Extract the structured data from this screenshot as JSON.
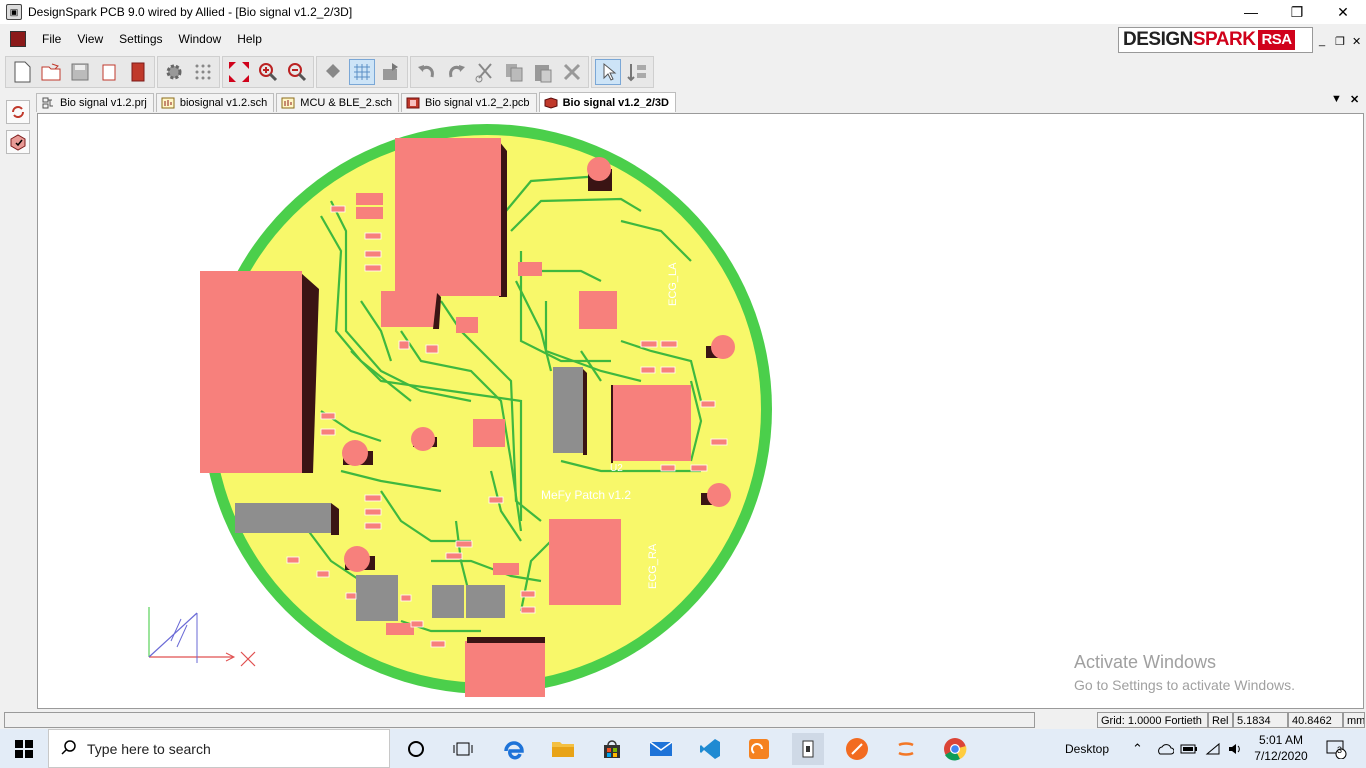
{
  "window": {
    "title": "DesignSpark PCB 9.0 wired by Allied - [Bio signal v1.2_2/3D]"
  },
  "menu": [
    "File",
    "View",
    "Settings",
    "Window",
    "Help"
  ],
  "logo": {
    "part1": "DESIGN",
    "part2": "SPARK",
    "part3": "RSA"
  },
  "tabs": [
    {
      "label": "Bio signal v1.2.prj"
    },
    {
      "label": "biosignal v1.2.sch"
    },
    {
      "label": "MCU & BLE_2.sch"
    },
    {
      "label": "Bio signal v1.2_2.pcb"
    },
    {
      "label": "Bio signal v1.2_2/3D"
    }
  ],
  "board_text": {
    "patch_name": "MeFy Patch v1.2",
    "ecg_la": "ECG_LA",
    "ecg_ra": "ECG_RA",
    "u2": "U2"
  },
  "activate": {
    "line1": "Activate Windows",
    "line2": "Go to Settings to activate Windows."
  },
  "status": {
    "grid": "Grid: 1.0000 Fortieth",
    "rel": "Rel",
    "x": "5.1834",
    "y": "40.8462",
    "units": "mm"
  },
  "taskbar": {
    "search_placeholder": "Type here to search",
    "desktop": "Desktop",
    "time": "5:01 AM",
    "date": "7/12/2020",
    "notifications": "3"
  },
  "colors": {
    "board_yellow": "#f8f86a",
    "board_rim": "#4bcf4b",
    "trace": "#3fb83f",
    "component_pink": "#f7807c",
    "component_grey": "#8e8e8e",
    "shadow": "#3a1414"
  }
}
